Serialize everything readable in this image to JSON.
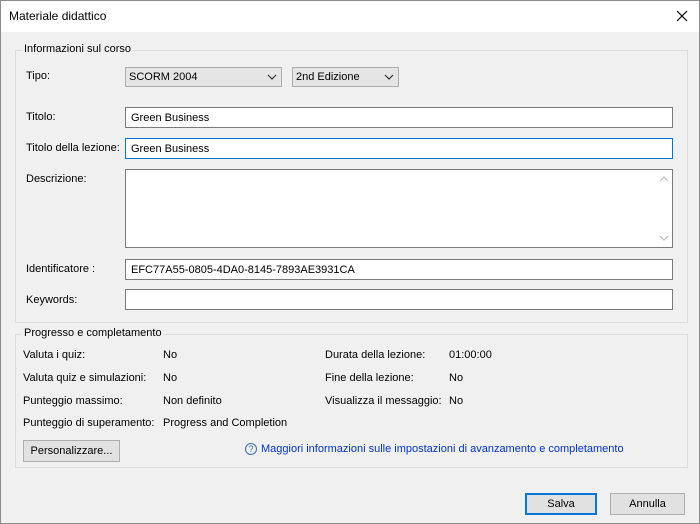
{
  "window": {
    "title": "Materiale didattico"
  },
  "course_info": {
    "group_title": "Informazioni sul corso",
    "tipo_label": "Tipo:",
    "tipo_value": "SCORM 2004",
    "edition_value": "2nd Edizione",
    "titolo_label": "Titolo:",
    "titolo_value": "Green Business",
    "lesson_title_label": "Titolo della lezione:",
    "lesson_title_value": "Green Business",
    "descrizione_label": "Descrizione:",
    "descrizione_value": "",
    "identificatore_label": "Identificatore :",
    "identificatore_value": "EFC77A55-0805-4DA0-8145-7893AE3931CA",
    "keywords_label": "Keywords:",
    "keywords_value": ""
  },
  "progress": {
    "group_title": "Progresso e completamento",
    "left": [
      {
        "label": "Valuta  i quiz:",
        "value": "No"
      },
      {
        "label": "Valuta quiz e simulazioni:",
        "value": "No"
      },
      {
        "label": "Punteggio massimo:",
        "value": "Non definito"
      },
      {
        "label": "Punteggio di superamento:",
        "value": "Progress and Completion"
      }
    ],
    "right": [
      {
        "label": "Durata della lezione:",
        "value": "01:00:00"
      },
      {
        "label": "Fine della lezione:",
        "value": "No"
      },
      {
        "label": "Visualizza il  messaggio:",
        "value": "No"
      }
    ],
    "customize_button": "Personalizzare...",
    "help_link": "Maggiori informazioni sulle impostazioni di avanzamento e completamento"
  },
  "footer": {
    "save_button": "Salva",
    "cancel_button": "Annulla"
  },
  "icons": {
    "close": "close-icon",
    "dropdown": "chevron-down-icon",
    "help": "help-icon"
  },
  "colors": {
    "accent": "#0078d7",
    "link": "#0033cc"
  }
}
